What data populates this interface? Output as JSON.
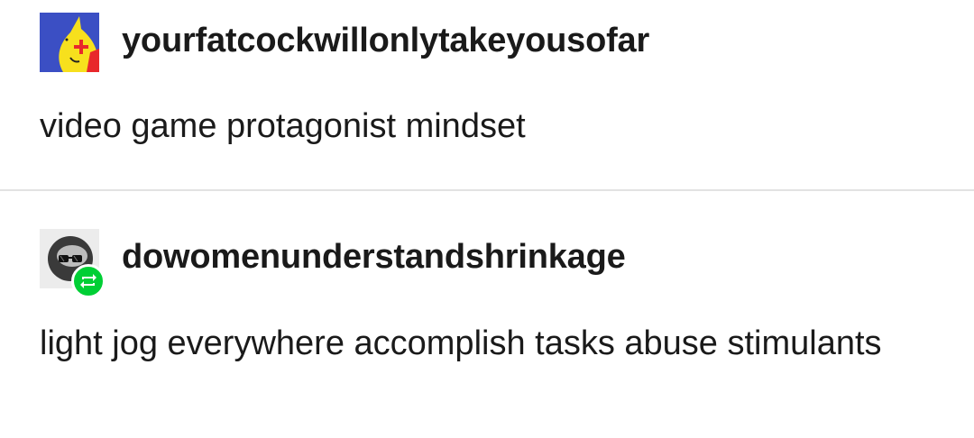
{
  "posts": [
    {
      "username": "yourfatcockwillonlytakeyousofar",
      "avatar_icon": "yellow-cartoon-avatar-icon",
      "text": "video game protagonist mindset"
    },
    {
      "username": "dowomenunderstandshrinkage",
      "avatar_icon": "sunglasses-avatar-icon",
      "badge_icon": "reblog-icon",
      "text": "light jog everywhere accomplish tasks abuse stimulants"
    }
  ],
  "colors": {
    "background": "#ffffff",
    "text": "#1a1a1a",
    "divider": "#e2e2e2",
    "reblog_green": "#00cf35",
    "avatar1_blue": "#3b4fc4",
    "avatar1_yellow": "#f7e01d",
    "avatar1_red": "#e8282b"
  }
}
